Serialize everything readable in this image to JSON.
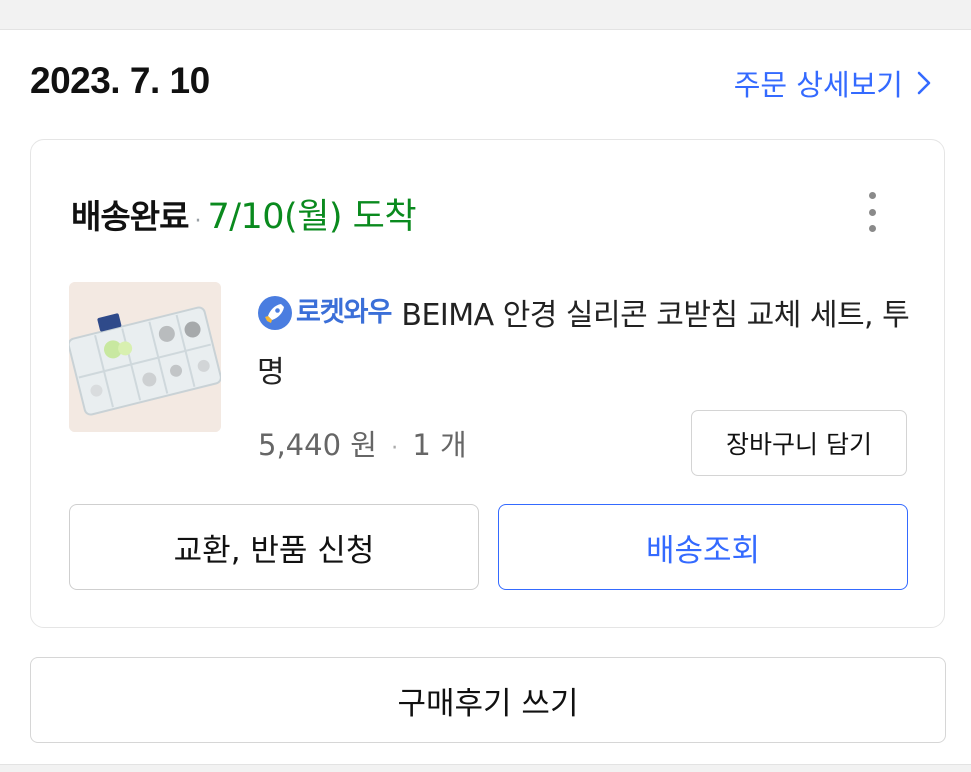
{
  "order": {
    "date": "2023. 7. 10",
    "detail_link": "주문 상세보기"
  },
  "shipment": {
    "status": "배송완료",
    "separator": "·",
    "arrival": "7/10(월) 도착"
  },
  "product": {
    "badge": "로켓와우",
    "title": "BEIMA 안경 실리콘 코받침 교체 세트, 투명",
    "price": "5,440 원",
    "price_separator": "·",
    "quantity": "1 개"
  },
  "buttons": {
    "add_to_cart": "장바구니 담기",
    "exchange_return": "교환, 반품 신청",
    "track_delivery": "배송조회",
    "write_review": "구매후기 쓰기"
  },
  "colors": {
    "accent": "#346aff",
    "delivered": "#0a8a1e"
  },
  "icons": {
    "detail": "chevron-right-icon",
    "more": "more-vertical-icon",
    "badge": "rocket-icon"
  }
}
